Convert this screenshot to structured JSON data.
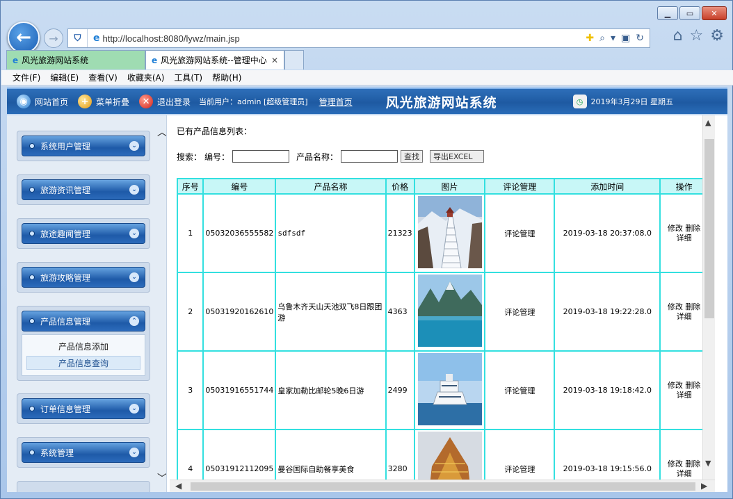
{
  "browser": {
    "url": "http://localhost:8080/lywz/main.jsp",
    "tabs": [
      {
        "label": "风光旅游网站系统"
      },
      {
        "label": "风光旅游网站系统--管理中心"
      }
    ],
    "menu": [
      "文件(F)",
      "编辑(E)",
      "查看(V)",
      "收藏夹(A)",
      "工具(T)",
      "帮助(H)"
    ]
  },
  "header": {
    "home_label": "网站首页",
    "collapse_label": "菜单折叠",
    "logout_label": "退出登录",
    "current_user": "当前用户：admin [超级管理员]",
    "admin_home": "管理首页",
    "site_title": "风光旅游网站系统",
    "date": "2019年3月29日 星期五"
  },
  "sidebar": {
    "groups": [
      {
        "label": "系统用户管理"
      },
      {
        "label": "旅游资讯管理"
      },
      {
        "label": "旅途趣闻管理"
      },
      {
        "label": "旅游攻略管理"
      },
      {
        "label": "产品信息管理",
        "subitems": [
          "产品信息添加",
          "产品信息查询"
        ]
      },
      {
        "label": "订单信息管理"
      },
      {
        "label": "系统管理"
      }
    ]
  },
  "main": {
    "list_title": "已有产品信息列表：",
    "search_label": "搜索：",
    "code_label": "编号：",
    "code_value": "",
    "name_label": "产品名称：",
    "name_value": "",
    "search_button": "查找",
    "export_button": "导出EXCEL",
    "columns": [
      "序号",
      "编号",
      "产品名称",
      "价格",
      "图片",
      "评论管理",
      "添加时间",
      "操作"
    ],
    "rows": [
      {
        "no": "1",
        "code": "05032036555582",
        "name": "sdfsdf",
        "price": "21323",
        "review": "评论管理",
        "time": "2019-03-18 20:37:08.0",
        "edit": "修改",
        "del": "删除",
        "detail": "详细"
      },
      {
        "no": "2",
        "code": "05031920162610",
        "name": "乌鲁木齐天山天池双飞8日跟团游",
        "price": "4363",
        "review": "评论管理",
        "time": "2019-03-18 19:22:28.0",
        "edit": "修改",
        "del": "删除",
        "detail": "详细"
      },
      {
        "no": "3",
        "code": "05031916551744",
        "name": "皇家加勒比邮轮5晚6日游",
        "price": "2499",
        "review": "评论管理",
        "time": "2019-03-18 19:18:42.0",
        "edit": "修改",
        "del": "删除",
        "detail": "详细"
      },
      {
        "no": "4",
        "code": "05031912112095",
        "name": "曼谷国际自助餐享美食",
        "price": "3280",
        "review": "评论管理",
        "time": "2019-03-18 19:15:56.0",
        "edit": "修改",
        "del": "删除",
        "detail": "详细"
      }
    ]
  }
}
